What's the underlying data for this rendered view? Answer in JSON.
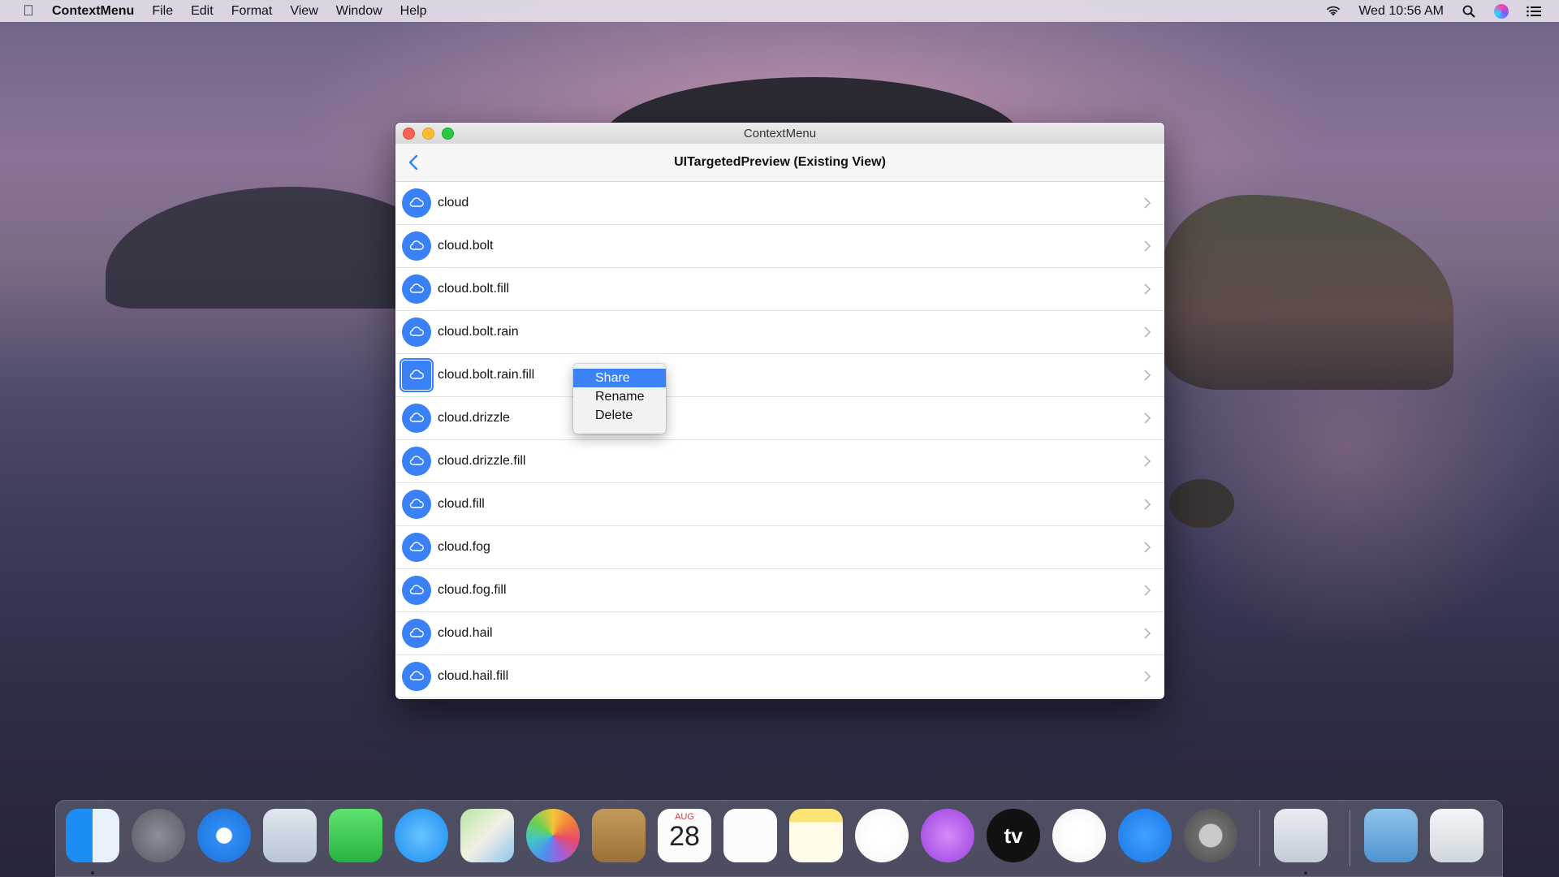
{
  "menubar": {
    "app_name": "ContextMenu",
    "menus": [
      "File",
      "Edit",
      "Format",
      "View",
      "Window",
      "Help"
    ],
    "clock": "Wed 10:56 AM",
    "icons": [
      "apple-icon",
      "wifi-icon",
      "spotlight-icon",
      "siri-icon",
      "notification-center-icon"
    ]
  },
  "window": {
    "title": "ContextMenu",
    "nav_title": "UITargetedPreview (Existing View)",
    "rows": [
      {
        "label": "cloud"
      },
      {
        "label": "cloud.bolt"
      },
      {
        "label": "cloud.bolt.fill"
      },
      {
        "label": "cloud.bolt.rain"
      },
      {
        "label": "cloud.bolt.rain.fill"
      },
      {
        "label": "cloud.drizzle"
      },
      {
        "label": "cloud.drizzle.fill"
      },
      {
        "label": "cloud.fill"
      },
      {
        "label": "cloud.fog"
      },
      {
        "label": "cloud.fog.fill"
      },
      {
        "label": "cloud.hail"
      },
      {
        "label": "cloud.hail.fill"
      }
    ]
  },
  "context_menu": {
    "items": [
      "Share",
      "Rename",
      "Delete"
    ],
    "highlighted": "Share"
  },
  "dock": {
    "apps": [
      "Finder",
      "Launchpad",
      "Safari",
      "Mail",
      "FaceTime",
      "Messages",
      "Maps",
      "Photos",
      "Contacts",
      "Calendar",
      "Reminders",
      "Notes",
      "Music",
      "Podcasts",
      "TV",
      "News",
      "App Store",
      "System Preferences",
      "Xcode",
      "Downloads",
      "Trash"
    ],
    "calendar_month": "AUG",
    "calendar_day": "28",
    "tv_label": "tv"
  },
  "colors": {
    "accent": "#3a80f6",
    "menu_highlight": "#3b82f6"
  }
}
